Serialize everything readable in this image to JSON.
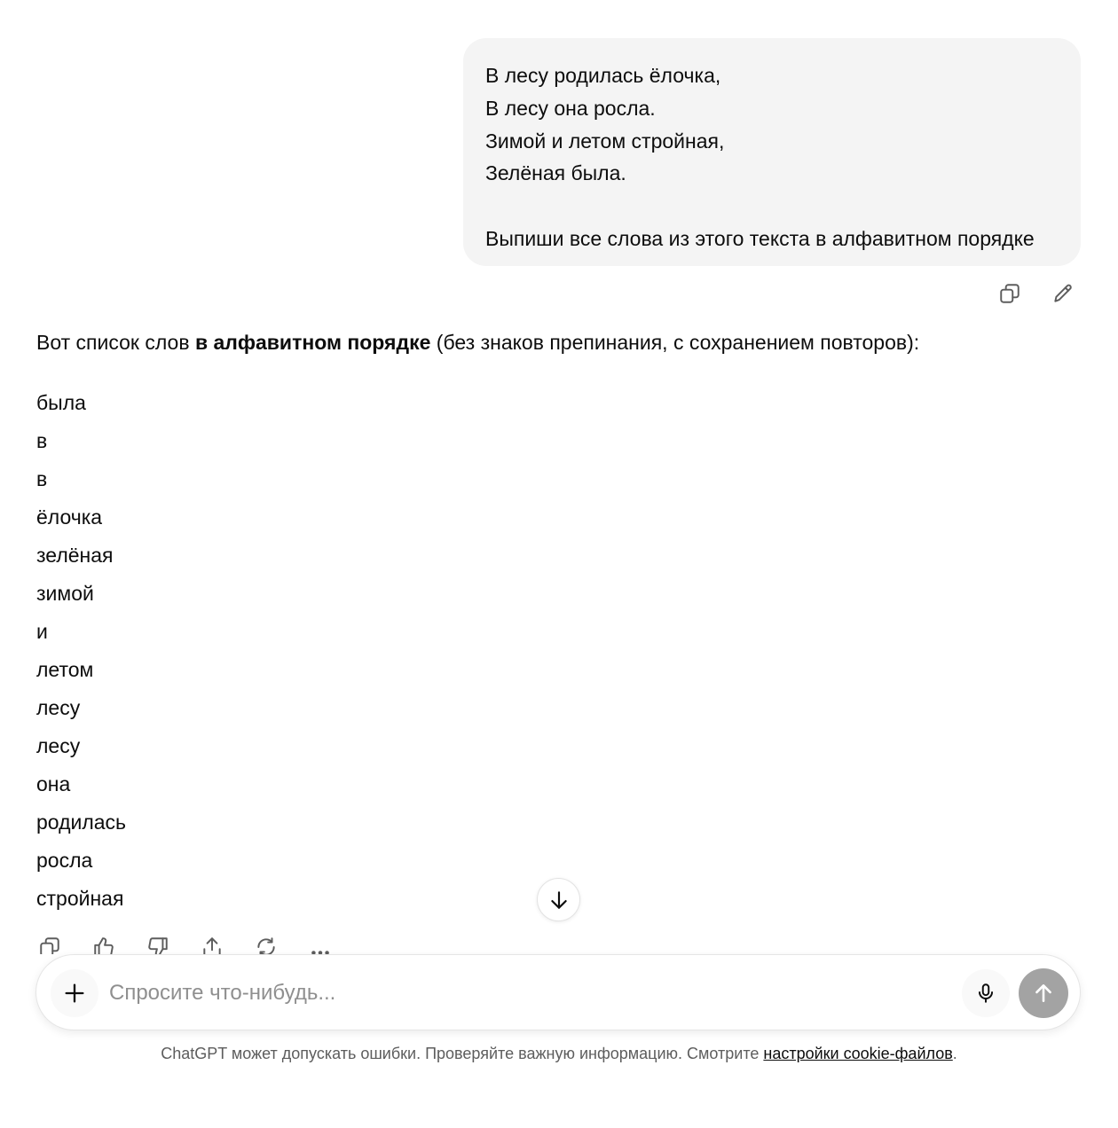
{
  "user_message": {
    "lines": [
      "В лесу родилась ёлочка,",
      "В лесу она росла.",
      "Зимой и летом стройная,",
      "Зелёная была."
    ],
    "request": "Выпиши все слова из этого текста в алфавитном порядке"
  },
  "user_actions": {
    "copy_icon": "copy-icon",
    "edit_icon": "pencil-icon"
  },
  "assistant": {
    "intro_before": "Вот список слов ",
    "intro_bold": "в алфавитном порядке",
    "intro_after": " (без знаков препинания, с сохранением повторов):",
    "words": [
      "была",
      "в",
      "в",
      "ёлочка",
      "зелёная",
      "зимой",
      "и",
      "летом",
      "лесу",
      "лесу",
      "она",
      "родилась",
      "росла",
      "стройная"
    ]
  },
  "message_actions": [
    "copy-icon",
    "thumbs-up-icon",
    "thumbs-down-icon",
    "share-icon",
    "regenerate-icon",
    "more-icon"
  ],
  "composer": {
    "placeholder": "Спросите что-нибудь..."
  },
  "disclaimer": {
    "text": "ChatGPT может допускать ошибки. Проверяйте важную информацию. Смотрите ",
    "link": "настройки cookie-файлов",
    "end": "."
  },
  "colors": {
    "user_bubble": "#f4f4f4",
    "send_button": "#a3a3a3",
    "text": "#0d0d0d",
    "muted": "#5d5d5d"
  }
}
